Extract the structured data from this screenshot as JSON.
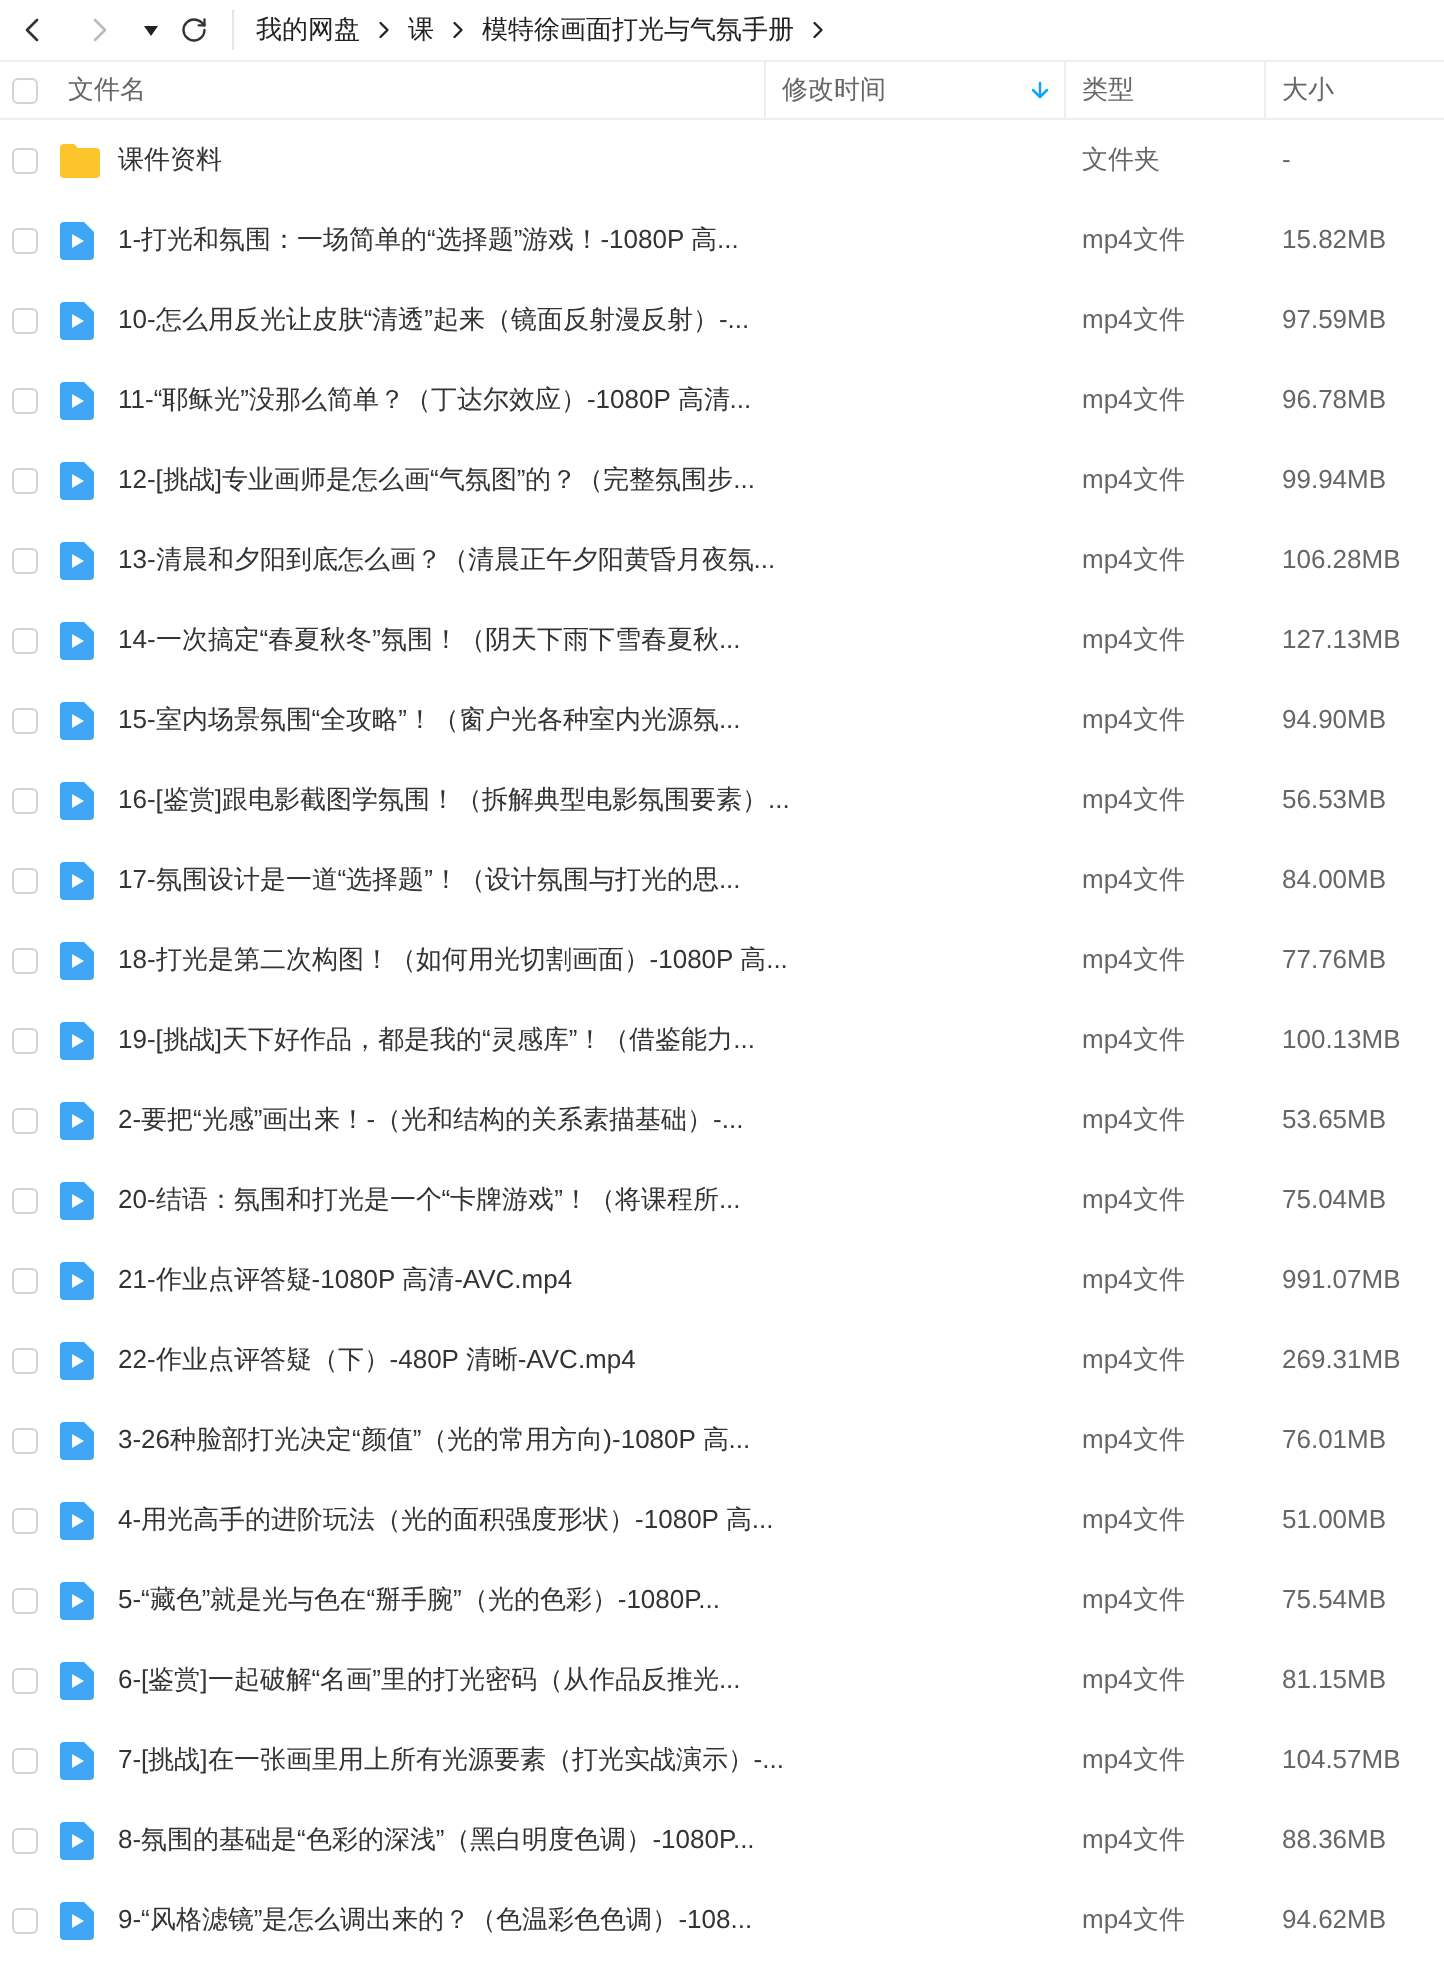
{
  "breadcrumb": [
    "我的网盘",
    "课",
    "模特徐画面打光与气氛手册"
  ],
  "table": {
    "columns": [
      {
        "label": "文件名",
        "sorted": false
      },
      {
        "label": "修改时间",
        "sorted": true
      },
      {
        "label": "类型",
        "sorted": false
      },
      {
        "label": "大小",
        "sorted": false
      }
    ],
    "header_checked": false,
    "rows": [
      {
        "kind": "folder",
        "checked": false,
        "name": "课件资料",
        "type": "文件夹",
        "size": "-"
      },
      {
        "kind": "video",
        "checked": false,
        "name": "1-打光和氛围：一场简单的“选择题”游戏！-1080P 高...",
        "type": "mp4文件",
        "size": "15.82MB"
      },
      {
        "kind": "video",
        "checked": false,
        "name": "10-怎么用反光让皮肤“清透”起来（镜面反射漫反射）-...",
        "type": "mp4文件",
        "size": "97.59MB"
      },
      {
        "kind": "video",
        "checked": false,
        "name": "11-“耶稣光”没那么简单？（丁达尔效应）-1080P 高清...",
        "type": "mp4文件",
        "size": "96.78MB"
      },
      {
        "kind": "video",
        "checked": false,
        "name": "12-[挑战]专业画师是怎么画“气氛图”的？（完整氛围步...",
        "type": "mp4文件",
        "size": "99.94MB"
      },
      {
        "kind": "video",
        "checked": false,
        "name": "13-清晨和夕阳到底怎么画？（清晨正午夕阳黄昏月夜氛...",
        "type": "mp4文件",
        "size": "106.28MB"
      },
      {
        "kind": "video",
        "checked": false,
        "name": "14-一次搞定“春夏秋冬”氛围！（阴天下雨下雪春夏秋...",
        "type": "mp4文件",
        "size": "127.13MB"
      },
      {
        "kind": "video",
        "checked": false,
        "name": "15-室内场景氛围“全攻略”！（窗户光各种室内光源氛...",
        "type": "mp4文件",
        "size": "94.90MB"
      },
      {
        "kind": "video",
        "checked": false,
        "name": "16-[鉴赏]跟电影截图学氛围！（拆解典型电影氛围要素）...",
        "type": "mp4文件",
        "size": "56.53MB"
      },
      {
        "kind": "video",
        "checked": false,
        "name": "17-氛围设计是一道“选择题”！（设计氛围与打光的思...",
        "type": "mp4文件",
        "size": "84.00MB"
      },
      {
        "kind": "video",
        "checked": false,
        "name": "18-打光是第二次构图！（如何用光切割画面）-1080P 高...",
        "type": "mp4文件",
        "size": "77.76MB"
      },
      {
        "kind": "video",
        "checked": false,
        "name": "19-[挑战]天下好作品，都是我的“灵感库”！（借鉴能力...",
        "type": "mp4文件",
        "size": "100.13MB"
      },
      {
        "kind": "video",
        "checked": false,
        "name": "2-要把“光感”画出来！-（光和结构的关系素描基础）-...",
        "type": "mp4文件",
        "size": "53.65MB"
      },
      {
        "kind": "video",
        "checked": false,
        "name": "20-结语：氛围和打光是一个“卡牌游戏”！（将课程所...",
        "type": "mp4文件",
        "size": "75.04MB"
      },
      {
        "kind": "video",
        "checked": false,
        "name": "21-作业点评答疑-1080P 高清-AVC.mp4",
        "type": "mp4文件",
        "size": "991.07MB"
      },
      {
        "kind": "video",
        "checked": false,
        "name": "22-作业点评答疑（下）-480P 清晰-AVC.mp4",
        "type": "mp4文件",
        "size": "269.31MB"
      },
      {
        "kind": "video",
        "checked": false,
        "name": "3-26种脸部打光决定“颜值”（光的常用方向)-1080P 高...",
        "type": "mp4文件",
        "size": "76.01MB"
      },
      {
        "kind": "video",
        "checked": false,
        "name": "4-用光高手的进阶玩法（光的面积强度形状）-1080P 高...",
        "type": "mp4文件",
        "size": "51.00MB"
      },
      {
        "kind": "video",
        "checked": false,
        "name": "5-“藏色”就是光与色在“掰手腕”（光的色彩）-1080P...",
        "type": "mp4文件",
        "size": "75.54MB"
      },
      {
        "kind": "video",
        "checked": false,
        "name": "6-[鉴赏]一起破解“名画”里的打光密码（从作品反推光...",
        "type": "mp4文件",
        "size": "81.15MB"
      },
      {
        "kind": "video",
        "checked": false,
        "name": "7-[挑战]在一张画里用上所有光源要素（打光实战演示）-...",
        "type": "mp4文件",
        "size": "104.57MB"
      },
      {
        "kind": "video",
        "checked": false,
        "name": "8-氛围的基础是“色彩的深浅”（黑白明度色调）-1080P...",
        "type": "mp4文件",
        "size": "88.36MB"
      },
      {
        "kind": "video",
        "checked": false,
        "name": "9-“风格滤镜”是怎么调出来的？（色温彩色色调）-108...",
        "type": "mp4文件",
        "size": "94.62MB"
      }
    ]
  }
}
